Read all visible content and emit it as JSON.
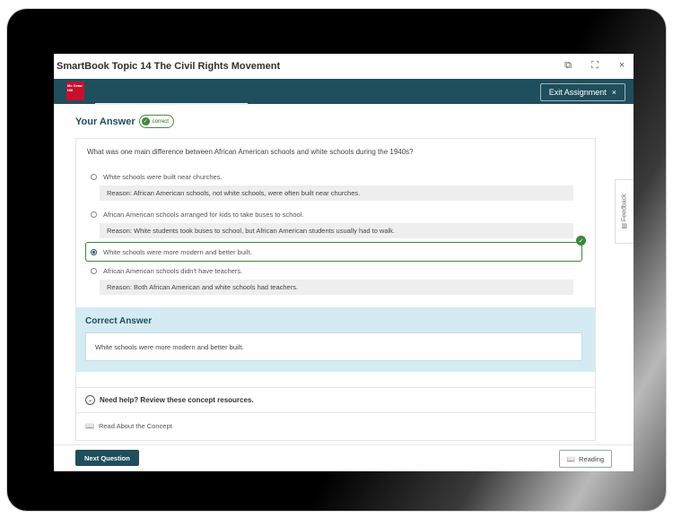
{
  "window": {
    "title": "SmartBook Topic 14 The Civil Rights Movement",
    "controls": [
      "external-icon",
      "fullscreen-icon",
      "close-icon"
    ]
  },
  "navbar": {
    "logo_text": "Mc Graw Hill",
    "exit_label": "Exit Assignment",
    "exit_icon": "×"
  },
  "answer": {
    "heading": "Your Answer",
    "badge": "correct"
  },
  "question": {
    "text": "What was one main difference between African American schools and white schools during the 1940s?",
    "options": [
      {
        "label": "White schools were built near churches.",
        "reason": "Reason: African American schools, not white schools, were often built near churches."
      },
      {
        "label": "African American schools arranged for kids to take buses to school.",
        "reason": "Reason: White students took buses to school, but African American students usually had to walk."
      },
      {
        "label": "White schools were more modern and better built.",
        "reason": ""
      },
      {
        "label": "African American schools didn't have teachers.",
        "reason": "Reason: Both African American and white schools had teachers."
      }
    ]
  },
  "correct_answer": {
    "title": "Correct Answer",
    "text": "White schools were more modern and better built."
  },
  "help": {
    "title": "Need help? Review these concept resources.",
    "link": "Read About the Concept"
  },
  "feedback": {
    "label": "Feedback"
  },
  "footer": {
    "next_label": "Next Question",
    "reading_label": "Reading"
  },
  "colors": {
    "nav": "#1f4e5c",
    "correct_green": "#3a8a32",
    "panel_blue": "#d4ebf3"
  }
}
